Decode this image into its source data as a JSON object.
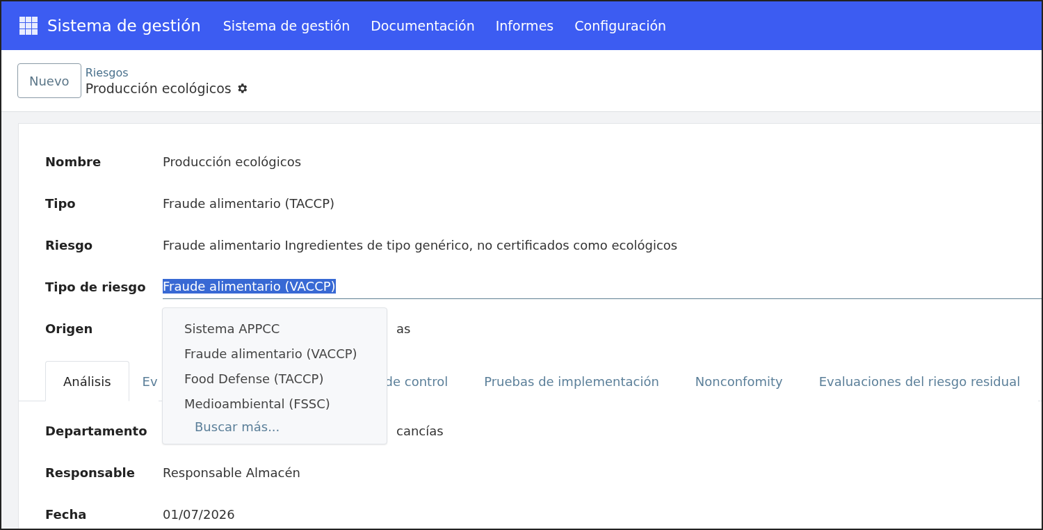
{
  "navbar": {
    "app_title": "Sistema de gestión",
    "menu": [
      "Sistema de gestión",
      "Documentación",
      "Informes",
      "Configuración"
    ]
  },
  "control_panel": {
    "new_button": "Nuevo",
    "breadcrumb": "Riesgos",
    "record_title": "Producción ecológicos"
  },
  "fields": [
    {
      "label": "Nombre",
      "value": "Producción ecológicos",
      "kind": "text"
    },
    {
      "label": "Tipo",
      "value": "Fraude alimentario (TACCP)",
      "kind": "text"
    },
    {
      "label": "Riesgo",
      "value": "Fraude alimentario Ingredientes de tipo genérico, no certificados como ecológicos",
      "kind": "text"
    },
    {
      "label": "Tipo de riesgo",
      "value": "Fraude alimentario (VACCP)",
      "kind": "input"
    },
    {
      "label": "Origen",
      "value": "as",
      "kind": "covered"
    }
  ],
  "dropdown": {
    "options": [
      "Sistema APPCC",
      "Fraude alimentario (VACCP)",
      "Food Defense (TACCP)",
      "Medioambiental (FSSC)"
    ],
    "search_more": "Buscar más..."
  },
  "tabs": [
    {
      "label": "Análisis",
      "selected": true,
      "kind": "full"
    },
    {
      "label": "Ev",
      "selected": false,
      "kind": "covered"
    },
    {
      "label": "de control",
      "selected": false,
      "kind": "after"
    },
    {
      "label": "Pruebas de implementación",
      "selected": false,
      "kind": "full"
    },
    {
      "label": "Nonconfomity",
      "selected": false,
      "kind": "full"
    },
    {
      "label": "Evaluaciones del riesgo residual",
      "selected": false,
      "kind": "full"
    }
  ],
  "tab_fields": [
    {
      "label": "Departamento",
      "value": "cancías",
      "kind": "covered"
    },
    {
      "label": "Responsable",
      "value": "Responsable Almacén",
      "kind": "text"
    },
    {
      "label": "Fecha",
      "value": "01/07/2026",
      "kind": "text"
    }
  ]
}
